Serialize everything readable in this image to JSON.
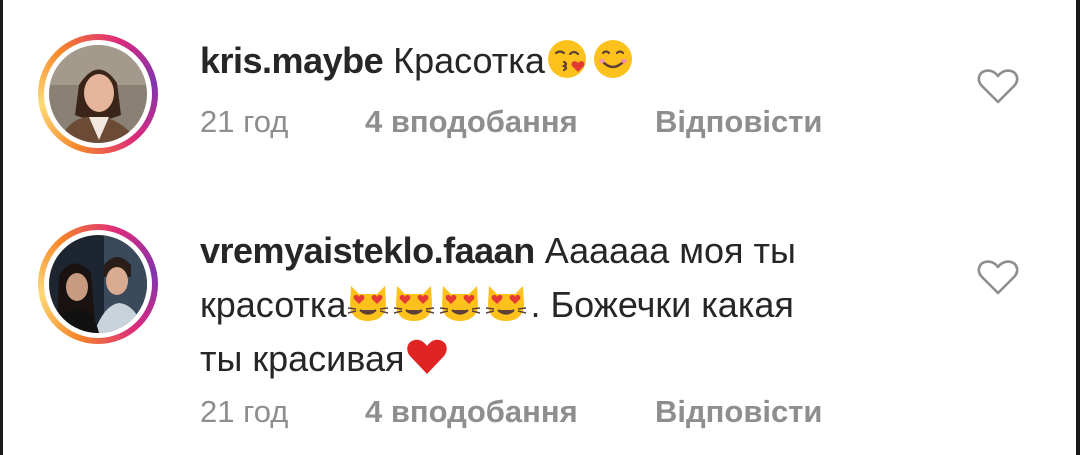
{
  "comments": [
    {
      "username": "kris.maybe",
      "text": "Красотка",
      "emojis_after_text": [
        "kissing-face-with-heart-emoji",
        "smiling-face-emoji"
      ],
      "time": "21 год",
      "likes": "4 вподобання",
      "reply_label": "Відповісти"
    },
    {
      "username": "vremyaisteklo.faaan",
      "text_1": "Аааааа моя ты",
      "text_2": "красотка",
      "emojis_mid": [
        "heart-eyes-cat-emoji",
        "heart-eyes-cat-emoji",
        "heart-eyes-cat-emoji",
        "heart-eyes-cat-emoji"
      ],
      "text_3": ". Божечки какая",
      "text_4": "ты красивая",
      "emojis_end": [
        "red-heart-emoji"
      ],
      "time": "21 год",
      "likes": "4 вподобання",
      "reply_label": "Відповісти"
    }
  ],
  "colors": {
    "text": "#262626",
    "meta": "#8e8e8e",
    "story_ring": [
      "#f58529",
      "#feda77",
      "#dd2a7b",
      "#8134af"
    ]
  },
  "icons": [
    "heart-outline-icon"
  ]
}
